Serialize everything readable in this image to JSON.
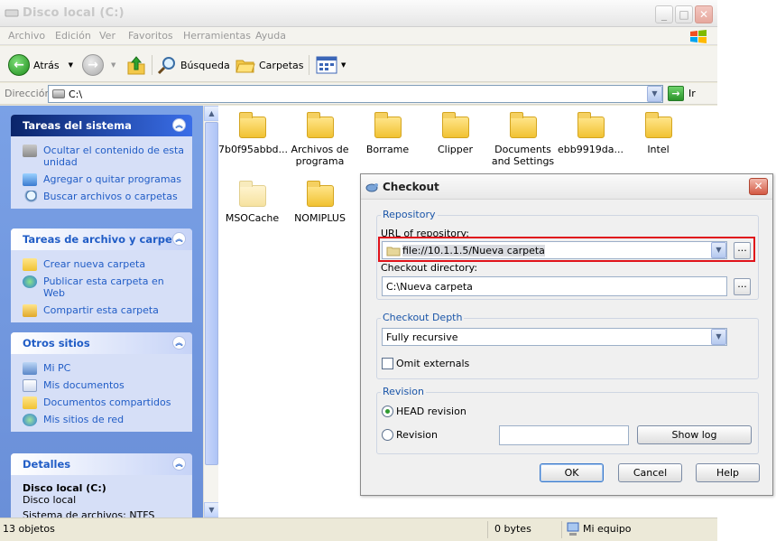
{
  "window": {
    "title": "Disco local (C:)"
  },
  "menu": [
    "Archivo",
    "Edición",
    "Ver",
    "Favoritos",
    "Herramientas",
    "Ayuda"
  ],
  "toolbar": {
    "back": "Atrás",
    "search": "Búsqueda",
    "folders": "Carpetas"
  },
  "address": {
    "label": "Dirección",
    "value": "C:\\",
    "go": "Ir"
  },
  "tasks": {
    "system": {
      "title": "Tareas del sistema",
      "items": [
        "Ocultar el contenido de esta unidad",
        "Agregar o quitar programas",
        "Buscar archivos o carpetas"
      ]
    },
    "file": {
      "title": "Tareas de archivo y carpeta",
      "items": [
        "Crear nueva carpeta",
        "Publicar esta carpeta en Web",
        "Compartir esta carpeta"
      ]
    },
    "other": {
      "title": "Otros sitios",
      "items": [
        "Mi PC",
        "Mis documentos",
        "Documentos compartidos",
        "Mis sitios de red"
      ]
    },
    "details": {
      "title": "Detalles",
      "name": "Disco local (C:)",
      "type": "Disco local",
      "fs": "Sistema de archivos: NTFS"
    }
  },
  "files": [
    {
      "name": "7b0f95abbd..."
    },
    {
      "name": "Archivos de programa"
    },
    {
      "name": "Borrame"
    },
    {
      "name": "Clipper"
    },
    {
      "name": "Documents and Settings"
    },
    {
      "name": "ebb9919da..."
    },
    {
      "name": "Intel"
    },
    {
      "name": "MSOCache"
    },
    {
      "name": "NOMIPLUS"
    }
  ],
  "status": {
    "objects": "13 objetos",
    "size": "0 bytes",
    "location": "Mi equipo"
  },
  "dialog": {
    "title": "Checkout",
    "repository": {
      "group": "Repository",
      "url_label": "URL of repository:",
      "url_value": "file://10.1.1.5/Nueva carpeta",
      "dir_label": "Checkout directory:",
      "dir_value": "C:\\Nueva carpeta"
    },
    "depth": {
      "group": "Checkout Depth",
      "value": "Fully recursive",
      "omit": "Omit externals"
    },
    "revision": {
      "group": "Revision",
      "head": "HEAD revision",
      "rev": "Revision",
      "show_log": "Show log"
    },
    "buttons": {
      "ok": "OK",
      "cancel": "Cancel",
      "help": "Help"
    },
    "ellipsis": "..."
  }
}
